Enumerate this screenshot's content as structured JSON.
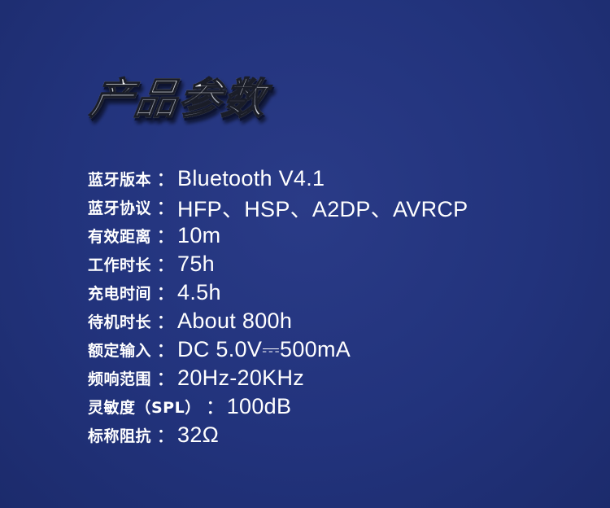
{
  "title": "产品参数",
  "specs": [
    {
      "label": "蓝牙版本",
      "sep": "：",
      "value": "Bluetooth V4.1"
    },
    {
      "label": "蓝牙协议",
      "sep": "：",
      "value": "HFP、HSP、A2DP、AVRCP"
    },
    {
      "label": "有效距离",
      "sep": "：",
      "value": "10m"
    },
    {
      "label": "工作时长",
      "sep": "：",
      "value": "75h"
    },
    {
      "label": "充电时间",
      "sep": "：",
      "value": "4.5h"
    },
    {
      "label": "待机时长",
      "sep": "：",
      "value": "About 800h"
    },
    {
      "label": "额定输入",
      "sep": "：",
      "value": "DC 5.0V⎓500mA"
    },
    {
      "label": "频响范围",
      "sep": "：",
      "value": "20Hz-20KHz"
    },
    {
      "label": "灵敏度（SPL）",
      "sep": "：",
      "value": "100dB"
    },
    {
      "label": "标称阻抗",
      "sep": "：",
      "value": "32Ω"
    }
  ],
  "colors": {
    "background": "#22337c",
    "text": "#ffffff"
  }
}
